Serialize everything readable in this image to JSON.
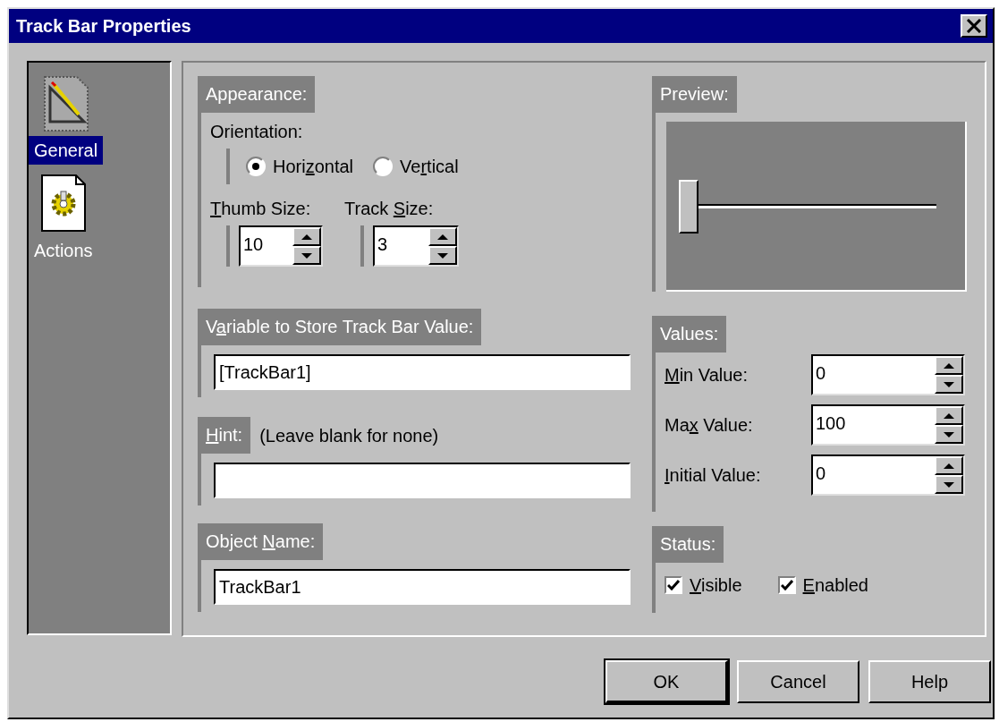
{
  "window": {
    "title": "Track Bar Properties"
  },
  "sidebar": {
    "items": [
      {
        "label": "General",
        "kind": "general",
        "selected": true
      },
      {
        "label": "Actions",
        "kind": "actions",
        "selected": false
      }
    ]
  },
  "appearance": {
    "title": "Appearance:",
    "orientation_label": "Orientation:",
    "orientation_options": [
      {
        "label_parts": [
          {
            "text": "Hori",
            "underlined": false
          },
          {
            "text": "z",
            "underlined": true
          },
          {
            "text": "ontal",
            "underlined": false
          }
        ],
        "selected": true
      },
      {
        "label_parts": [
          {
            "text": "Ve",
            "underlined": false
          },
          {
            "text": "r",
            "underlined": true
          },
          {
            "text": "tical",
            "underlined": false
          }
        ],
        "selected": false
      }
    ],
    "sizes": [
      {
        "label_parts": [
          {
            "text": "T",
            "underlined": true
          },
          {
            "text": "humb Size:",
            "underlined": false
          }
        ],
        "value": "10"
      },
      {
        "label_parts": [
          {
            "text": "Track ",
            "underlined": false
          },
          {
            "text": "S",
            "underlined": true
          },
          {
            "text": "ize:",
            "underlined": false
          }
        ],
        "value": "3"
      }
    ]
  },
  "preview": {
    "title": "Preview:",
    "level": 0
  },
  "variable": {
    "title_parts": [
      {
        "text": "V",
        "underlined": false
      },
      {
        "text": "a",
        "underlined": true
      },
      {
        "text": "riable to Store Track Bar Value:",
        "underlined": false
      }
    ],
    "value": "[TrackBar1]"
  },
  "hint": {
    "title_parts": [
      {
        "text": "H",
        "underlined": true
      },
      {
        "text": "int:",
        "underlined": false
      }
    ],
    "note": "(Leave blank for none)"
  },
  "object_name": {
    "title_parts": [
      {
        "text": "Object ",
        "underlined": false
      },
      {
        "text": "N",
        "underlined": true
      },
      {
        "text": "ame:",
        "underlined": false
      }
    ],
    "value": "TrackBar1"
  },
  "values": {
    "title": "Values:",
    "rows": [
      {
        "label_parts": [
          {
            "text": "M",
            "underlined": true
          },
          {
            "text": "in Value:",
            "underlined": false
          }
        ],
        "value": "0"
      },
      {
        "label_parts": [
          {
            "text": "Ma",
            "underlined": false
          },
          {
            "text": "x",
            "underlined": true
          },
          {
            "text": " Value:",
            "underlined": false
          }
        ],
        "value": "100"
      },
      {
        "label_parts": [
          {
            "text": "I",
            "underlined": true
          },
          {
            "text": "nitial Value:",
            "underlined": false
          }
        ],
        "value": "0"
      }
    ]
  },
  "status": {
    "title": "Status:",
    "options": [
      {
        "label_parts": [
          {
            "text": "V",
            "underlined": true
          },
          {
            "text": "isible",
            "underlined": false
          }
        ],
        "checked": true
      },
      {
        "label_parts": [
          {
            "text": "E",
            "underlined": true
          },
          {
            "text": "nabled",
            "underlined": false
          }
        ],
        "checked": true
      }
    ]
  },
  "buttons": [
    {
      "label": "OK",
      "default": true
    },
    {
      "label": "Cancel",
      "default": false
    },
    {
      "label": "Help",
      "default": false
    }
  ]
}
